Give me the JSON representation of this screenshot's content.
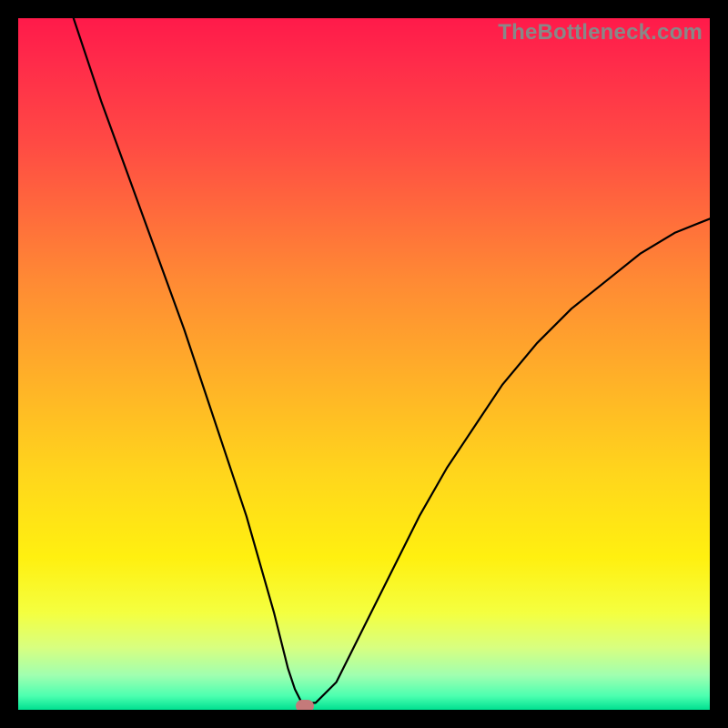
{
  "watermark": "TheBottleneck.com",
  "chart_data": {
    "type": "line",
    "title": "",
    "xlabel": "",
    "ylabel": "",
    "xlim": [
      0,
      100
    ],
    "ylim": [
      0,
      100
    ],
    "grid": false,
    "series": [
      {
        "name": "bottleneck-curve",
        "x": [
          8,
          12,
          16,
          20,
          24,
          27,
          30,
          33,
          35,
          37,
          38,
          39,
          40,
          41,
          42,
          43,
          44,
          46,
          48,
          50,
          54,
          58,
          62,
          66,
          70,
          75,
          80,
          85,
          90,
          95,
          100
        ],
        "y": [
          100,
          88,
          77,
          66,
          55,
          46,
          37,
          28,
          21,
          14,
          10,
          6,
          3,
          1,
          1,
          1,
          2,
          4,
          8,
          12,
          20,
          28,
          35,
          41,
          47,
          53,
          58,
          62,
          66,
          69,
          71
        ]
      }
    ],
    "annotations": [
      {
        "name": "optimal-marker",
        "x": 41.5,
        "y": 0.5
      }
    ],
    "background_gradient": {
      "top": "#ff1a4a",
      "mid": "#ffd000",
      "bottom": "#00e090"
    }
  }
}
